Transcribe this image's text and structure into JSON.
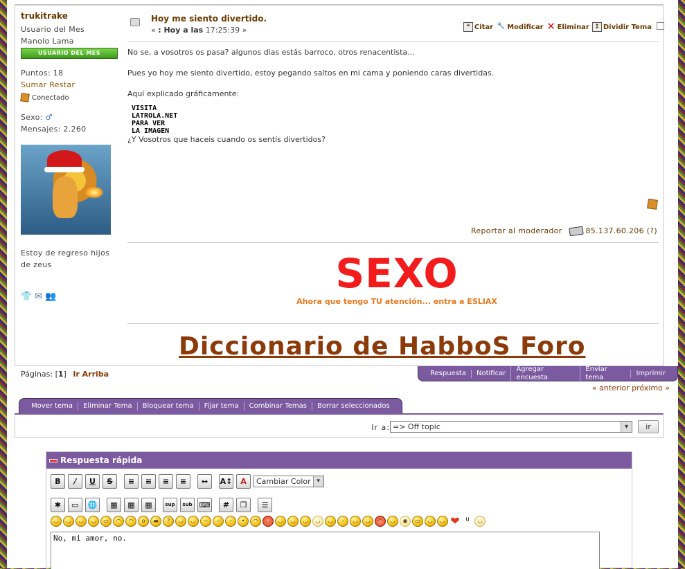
{
  "poster": {
    "name": "trukitrake",
    "rank": "Usuario del Mes",
    "title": "Manolo Lama",
    "rank_badge": "USUARIO DEL MES",
    "points": "Puntos: 18",
    "sumar_restar": "Sumar Restar",
    "status": "Conectado",
    "sex_label": "Sexo:",
    "sex_icon": "male-icon",
    "messages": "Mensajes: 2.260",
    "signature": "Estoy de regreso hijos de zeus"
  },
  "post": {
    "title": "Hoy me siento divertido.",
    "date_prefix": "«",
    "date_label": ": Hoy a las",
    "date_time": "17:25:39",
    "date_suffix": "»",
    "actions": [
      "Citar",
      "Modificar",
      "Eliminar",
      "Dividir Tema"
    ],
    "paragraphs": [
      "No se, a vosotros os pasa? algunos dias estás barroco, otros renacentista...",
      "Pues yo hoy me siento divertido, estoy pegando saltos en mi cama y poniendo caras divertidas.",
      "Aquí explicado gráficamente:"
    ],
    "image_placeholder": "VISITA\nLATROLA.NET\nPARA VER\nLA IMAGEN",
    "question": "¿Y Vosotros que haceis cuando os sentís divertidos?",
    "report": "Reportar al moderador",
    "ip": "85.137.60.206 (?)"
  },
  "banner": {
    "headline": "SEXO",
    "subline": "Ahora que tengo TU atención... entra a ESLIAX",
    "dictionary": "Diccionario de HabboS Foro"
  },
  "nav": {
    "pages_label": "Páginas: [",
    "page_current": "1",
    "pages_close": "]",
    "go_top": "Ir Arriba",
    "top_tabs": [
      "Respuesta",
      "Notificar",
      "Agregar encuesta",
      "Enviar tema",
      "Imprimir"
    ],
    "prev_next": "« anterior próximo »",
    "mod_tabs": [
      "Mover tema",
      "Eliminar Tema",
      "Bloquear tema",
      "Fijar tema",
      "Combinar Temas",
      "Borrar seleccionados"
    ]
  },
  "jump": {
    "label": "Ir a:",
    "selected": "=> Off topic",
    "button": "ir"
  },
  "quick_reply": {
    "title": "Respuesta rápida",
    "color_select": "Cambiar Color",
    "text": "No, mi amor, no."
  }
}
